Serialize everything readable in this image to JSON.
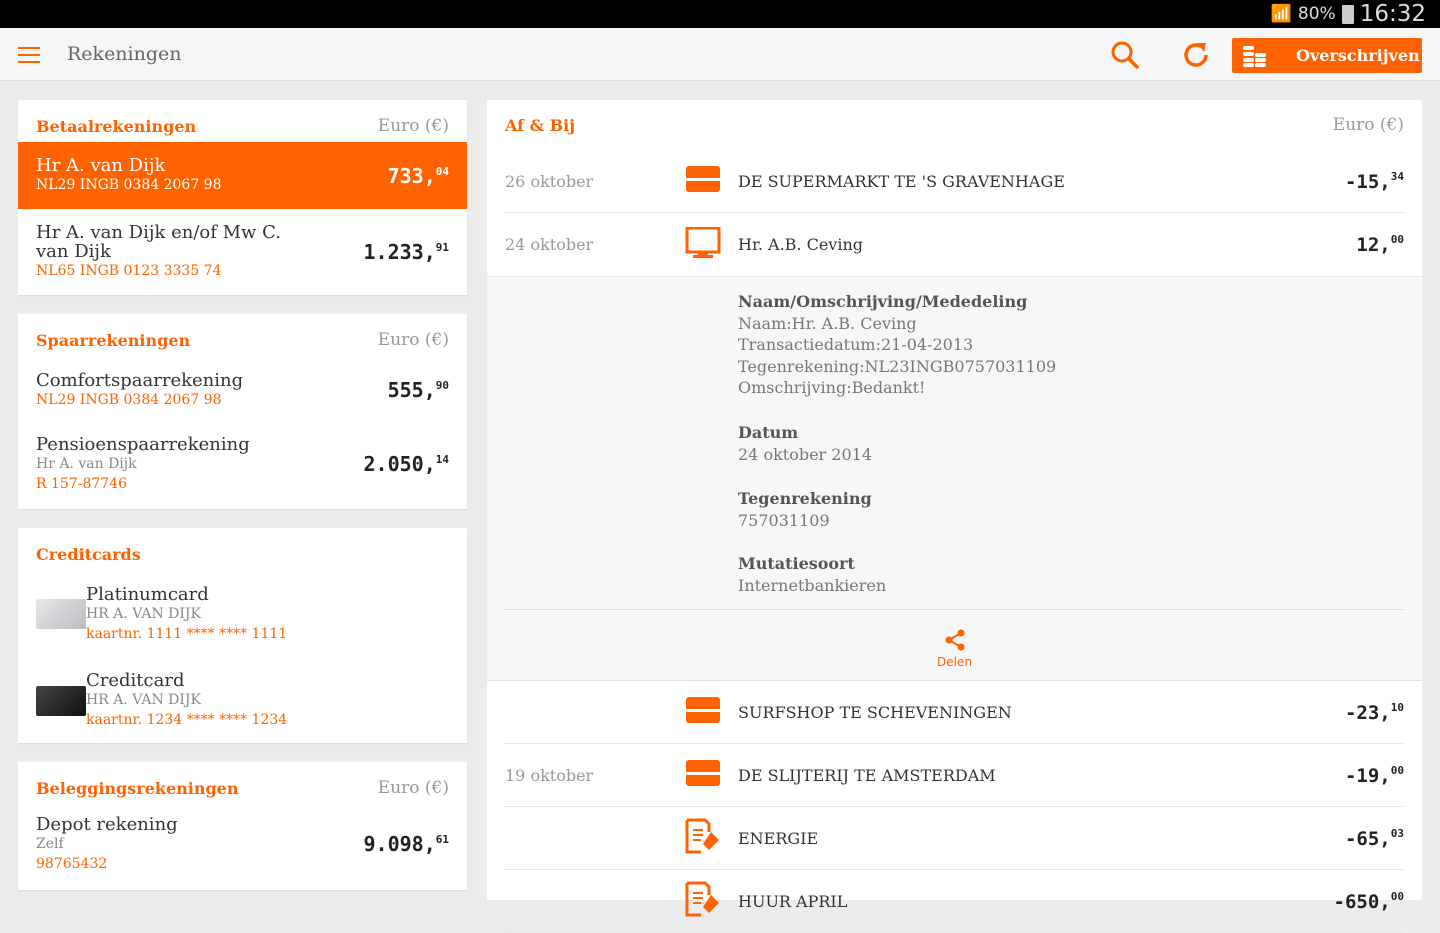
{
  "status": {
    "battery": "80%",
    "time": "16:32"
  },
  "appbar": {
    "title": "Rekeningen",
    "transfer_label": "Overschrijven"
  },
  "colors": {
    "accent": "#ff6200"
  },
  "betaal": {
    "title": "Betaalrekeningen",
    "currency": "Euro (€)",
    "accounts": [
      {
        "name": "Hr A. van Dijk",
        "iban": "NL29 INGB 0384 2067 98",
        "int": "733,",
        "dec": "04"
      },
      {
        "name": "Hr A. van Dijk en/of Mw C. van Dijk",
        "iban": "NL65 INGB 0123 3335 74",
        "int": "1.233,",
        "dec": "91"
      }
    ]
  },
  "spaar": {
    "title": "Spaarrekeningen",
    "currency": "Euro (€)",
    "accounts": [
      {
        "name": "Comfortspaarrekening",
        "iban": "NL29 INGB 0384 2067 98",
        "int": "555,",
        "dec": "90"
      },
      {
        "name": "Pensioenspaarrekening",
        "holder": "Hr A. van Dijk",
        "iban": "R 157-87746",
        "int": "2.050,",
        "dec": "14"
      }
    ]
  },
  "credit": {
    "title": "Creditcards",
    "cards": [
      {
        "name": "Platinumcard",
        "holder": "HR A. VAN DIJK",
        "number": "kaartnr. 1111 **** **** 1111"
      },
      {
        "name": "Creditcard",
        "holder": "HR A. VAN DIJK",
        "number": "kaartnr. 1234 **** **** 1234"
      }
    ]
  },
  "beleg": {
    "title": "Beleggingsrekeningen",
    "currency": "Euro (€)",
    "accounts": [
      {
        "name": "Depot rekening",
        "holder": "Zelf",
        "iban": "98765432",
        "int": "9.098,",
        "dec": "61"
      }
    ]
  },
  "afbij": {
    "title": "Af & Bij",
    "currency": "Euro (€)",
    "transactions": [
      {
        "date": "26 oktober",
        "icon": "card",
        "desc": "DE SUPERMARKT TE 'S GRAVENHAGE",
        "int": "-15,",
        "dec": "34"
      },
      {
        "date": "24 oktober",
        "icon": "computer",
        "desc": "Hr. A.B. Ceving",
        "int": "12,",
        "dec": "00"
      },
      {
        "date": "",
        "icon": "card",
        "desc": "SURFSHOP TE SCHEVENINGEN",
        "int": "-23,",
        "dec": "10"
      },
      {
        "date": "19 oktober",
        "icon": "card",
        "desc": "DE SLIJTERIJ TE AMSTERDAM",
        "int": "-19,",
        "dec": "00"
      },
      {
        "date": "",
        "icon": "invoice",
        "desc": "ENERGIE",
        "int": "-65,",
        "dec": "03"
      },
      {
        "date": "",
        "icon": "invoice",
        "desc": "HUUR APRIL",
        "int": "-650,",
        "dec": "00"
      }
    ],
    "detail": {
      "naam_label": "Naam/Omschrijving/Mededeling",
      "naam_lines": [
        "Naam:Hr. A.B. Ceving",
        "Transactiedatum:21-04-2013",
        "Tegenrekening:NL23INGB0757031109",
        "Omschrijving:Bedankt!"
      ],
      "datum_label": "Datum",
      "datum": "24 oktober 2014",
      "tegen_label": "Tegenrekening",
      "tegen": "757031109",
      "mut_label": "Mutatiesoort",
      "mut": "Internetbankieren",
      "share_label": "Delen"
    }
  }
}
